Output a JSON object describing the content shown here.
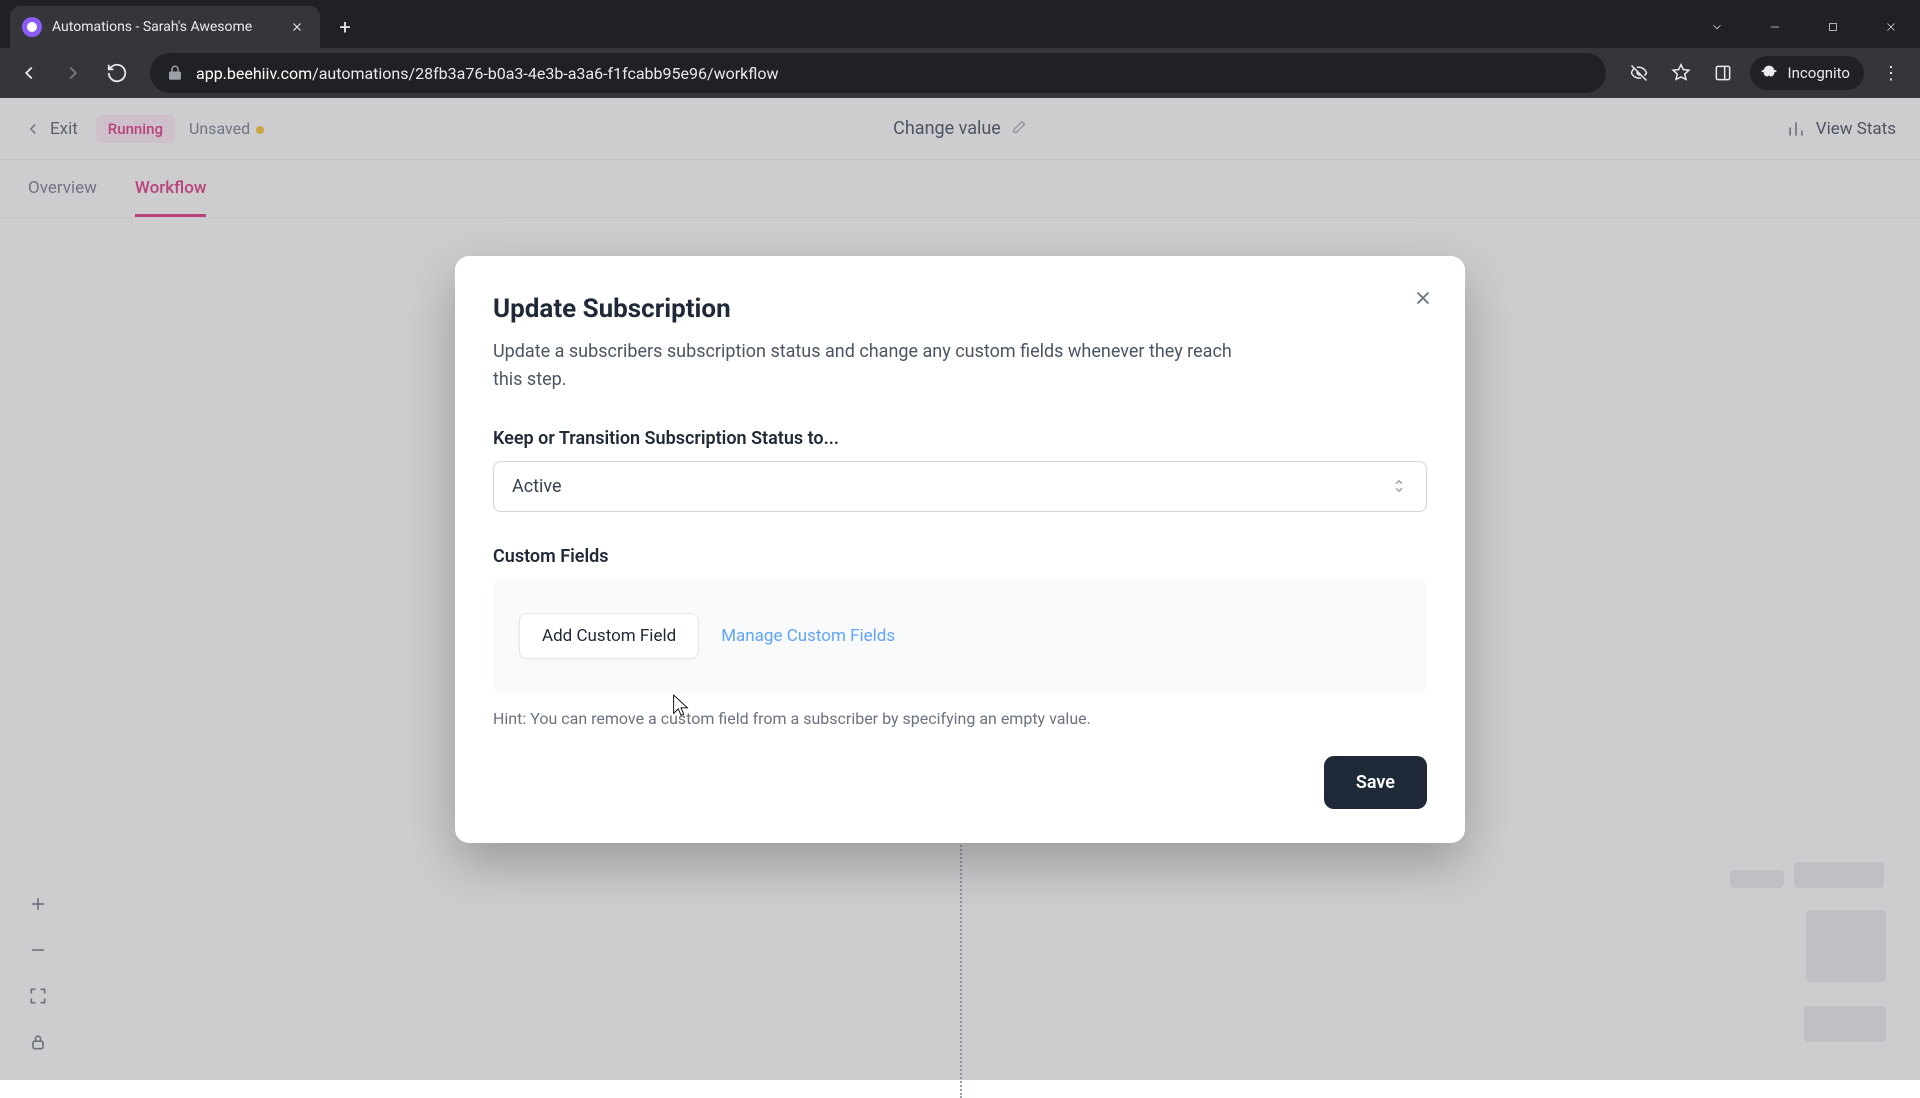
{
  "browser": {
    "tab_title": "Automations - Sarah's Awesome",
    "url_domain": "app.beehiiv.com",
    "url_path": "/automations/28fb3a76-b0a3-4e3b-a3a6-f1fcabb95e96/workflow",
    "incognito_label": "Incognito"
  },
  "header": {
    "exit": "Exit",
    "status": "Running",
    "unsaved": "Unsaved",
    "title": "Change value",
    "view_stats": "View Stats"
  },
  "tabs": {
    "overview": "Overview",
    "workflow": "Workflow"
  },
  "modal": {
    "title": "Update Subscription",
    "description": "Update a subscribers subscription status and change any custom fields whenever they reach this step.",
    "status_label": "Keep or Transition Subscription Status to...",
    "status_value": "Active",
    "custom_fields_label": "Custom Fields",
    "add_custom_field": "Add Custom Field",
    "manage_custom_fields": "Manage Custom Fields",
    "hint": "Hint: You can remove a custom field from a subscriber by specifying an empty value.",
    "save": "Save"
  }
}
